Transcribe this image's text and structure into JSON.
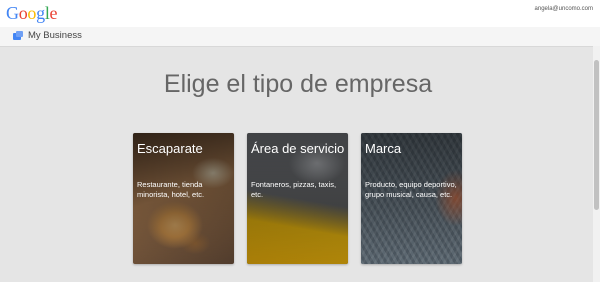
{
  "header": {
    "logo": {
      "letters": [
        "G",
        "o",
        "o",
        "g",
        "l",
        "e"
      ],
      "colors": [
        "#4285f4",
        "#ea4335",
        "#fbbc05",
        "#4285f4",
        "#34a853",
        "#ea4335"
      ]
    },
    "account_email": "angela@uncomo.com"
  },
  "subheader": {
    "icon": "my-business-icon",
    "label": "My Business"
  },
  "main": {
    "heading": "Elige el tipo de empresa",
    "cards": [
      {
        "title": "Escaparate",
        "description": "Restaurante, tienda minorista, hotel, etc.",
        "image": "pizza-photo"
      },
      {
        "title": "Área de servicio",
        "description": "Fontaneros, pizzas, taxis, etc.",
        "image": "taxi-street-photo"
      },
      {
        "title": "Marca",
        "description": "Producto, equipo deportivo, grupo musical, causa, etc.",
        "image": "knit-sweater-photo"
      }
    ]
  }
}
